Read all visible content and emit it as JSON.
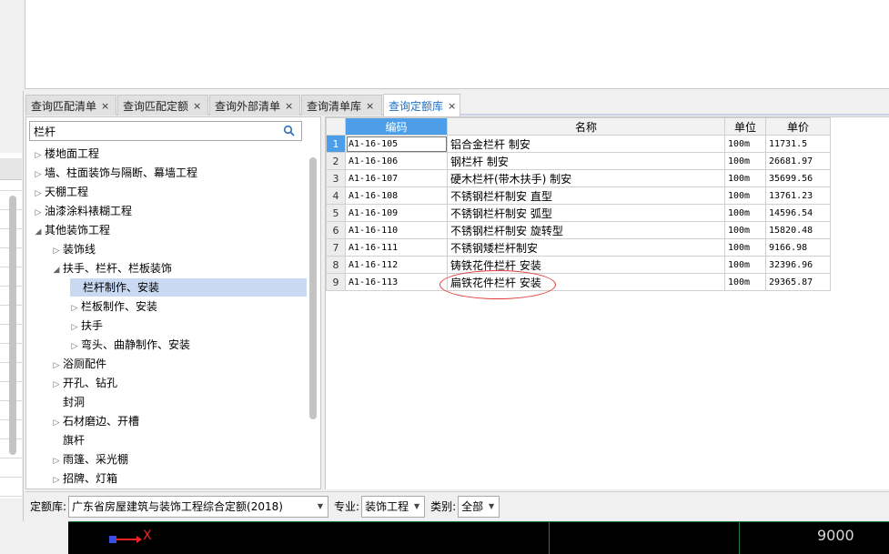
{
  "tabs": [
    {
      "label": "查询匹配清单",
      "close": "×"
    },
    {
      "label": "查询匹配定额",
      "close": "×"
    },
    {
      "label": "查询外部清单",
      "close": "×"
    },
    {
      "label": "查询清单库",
      "close": "×"
    },
    {
      "label": "查询定额库",
      "close": "×",
      "active": true
    }
  ],
  "search": {
    "value": "栏杆",
    "icon": "search-icon"
  },
  "tree": [
    {
      "label": "楼地面工程",
      "level": 0,
      "arrow": "▷"
    },
    {
      "label": "墙、柱面装饰与隔断、幕墙工程",
      "level": 0,
      "arrow": "▷"
    },
    {
      "label": "天棚工程",
      "level": 0,
      "arrow": "▷"
    },
    {
      "label": "油漆涂料裱糊工程",
      "level": 0,
      "arrow": "▷"
    },
    {
      "label": "其他装饰工程",
      "level": 0,
      "arrow": "◢"
    },
    {
      "label": "装饰线",
      "level": 1,
      "arrow": "▷"
    },
    {
      "label": "扶手、栏杆、栏板装饰",
      "level": 1,
      "arrow": "◢"
    },
    {
      "label": "栏杆制作、安装",
      "level": 2,
      "arrow": "",
      "selected": true
    },
    {
      "label": "栏板制作、安装",
      "level": 2,
      "arrow": "▷"
    },
    {
      "label": "扶手",
      "level": 2,
      "arrow": "▷"
    },
    {
      "label": "弯头、曲静制作、安装",
      "level": 2,
      "arrow": "▷"
    },
    {
      "label": "浴厕配件",
      "level": 1,
      "arrow": "▷"
    },
    {
      "label": "开孔、钻孔",
      "level": 1,
      "arrow": "▷"
    },
    {
      "label": "封洞",
      "level": 1,
      "arrow": ""
    },
    {
      "label": "石材磨边、开槽",
      "level": 1,
      "arrow": "▷"
    },
    {
      "label": "旗杆",
      "level": 1,
      "arrow": ""
    },
    {
      "label": "雨篷、采光棚",
      "level": 1,
      "arrow": "▷"
    },
    {
      "label": "招牌、灯箱",
      "level": 1,
      "arrow": "▷"
    }
  ],
  "table": {
    "headers": [
      "编码",
      "名称",
      "单位",
      "单价"
    ],
    "rows": [
      {
        "n": "1",
        "code": "A1-16-105",
        "name": "铝合金栏杆 制安",
        "unit": "100m",
        "price": "11731.5"
      },
      {
        "n": "2",
        "code": "A1-16-106",
        "name": "钢栏杆 制安",
        "unit": "100m",
        "price": "26681.97"
      },
      {
        "n": "3",
        "code": "A1-16-107",
        "name": "硬木栏杆(带木扶手) 制安",
        "unit": "100m",
        "price": "35699.56"
      },
      {
        "n": "4",
        "code": "A1-16-108",
        "name": "不锈钢栏杆制安 直型",
        "unit": "100m",
        "price": "13761.23"
      },
      {
        "n": "5",
        "code": "A1-16-109",
        "name": "不锈钢栏杆制安 弧型",
        "unit": "100m",
        "price": "14596.54"
      },
      {
        "n": "6",
        "code": "A1-16-110",
        "name": "不锈钢栏杆制安 旋转型",
        "unit": "100m",
        "price": "15820.48"
      },
      {
        "n": "7",
        "code": "A1-16-111",
        "name": "不锈钢矮栏杆制安",
        "unit": "100m",
        "price": "9166.98"
      },
      {
        "n": "8",
        "code": "A1-16-112",
        "name": "铸铁花件栏杆 安装",
        "unit": "100m",
        "price": "32396.96"
      },
      {
        "n": "9",
        "code": "A1-16-113",
        "name": "扁铁花件栏杆 安装",
        "unit": "100m",
        "price": "29365.87"
      }
    ]
  },
  "footer": {
    "quota_label": "定额库:",
    "quota_value": "广东省房屋建筑与装饰工程综合定额(2018)",
    "major_label": "专业:",
    "major_value": "装饰工程",
    "category_label": "类别:",
    "category_value": "全部"
  },
  "cad": {
    "dimension": "9000",
    "axis_label": "X"
  },
  "colors": {
    "accent": "#4c9ee8",
    "selected_row": "#c8d9f1",
    "annotation": "#e23a3a"
  }
}
